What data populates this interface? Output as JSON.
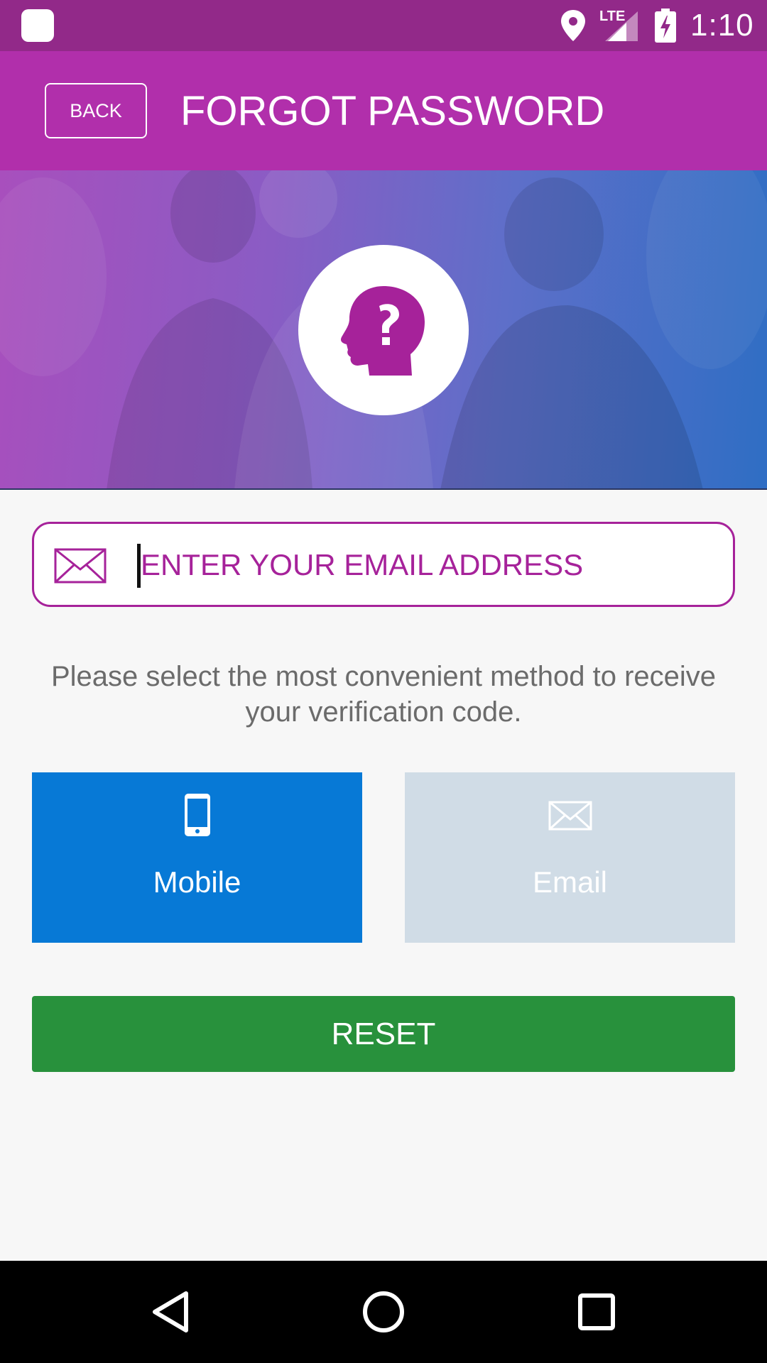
{
  "status_bar": {
    "time": "1:10",
    "network": "LTE",
    "background": "#922989",
    "icons": [
      "app-notification-icon",
      "location-pin-icon",
      "lte-signal-icon",
      "battery-charging-icon"
    ]
  },
  "header": {
    "back_label": "BACK",
    "title": "FORGOT PASSWORD",
    "background": "#b12fab"
  },
  "hero": {
    "icon": "head-question-icon"
  },
  "email_field": {
    "placeholder": "ENTER YOUR EMAIL ADDRESS",
    "value": "",
    "icon": "envelope-icon",
    "accent": "#a6229a"
  },
  "instructions": {
    "text": "Please select the most convenient method to receive your verification code."
  },
  "methods": [
    {
      "label": "Mobile",
      "icon": "mobile-phone-icon",
      "selected": true,
      "color": "#0779d6"
    },
    {
      "label": "Email",
      "icon": "envelope-icon",
      "selected": false,
      "color": "#d0dce6"
    }
  ],
  "reset": {
    "label": "RESET",
    "color": "#28913c"
  },
  "nav_bar": {
    "buttons": [
      "back-triangle-icon",
      "home-circle-icon",
      "recents-square-icon"
    ]
  }
}
